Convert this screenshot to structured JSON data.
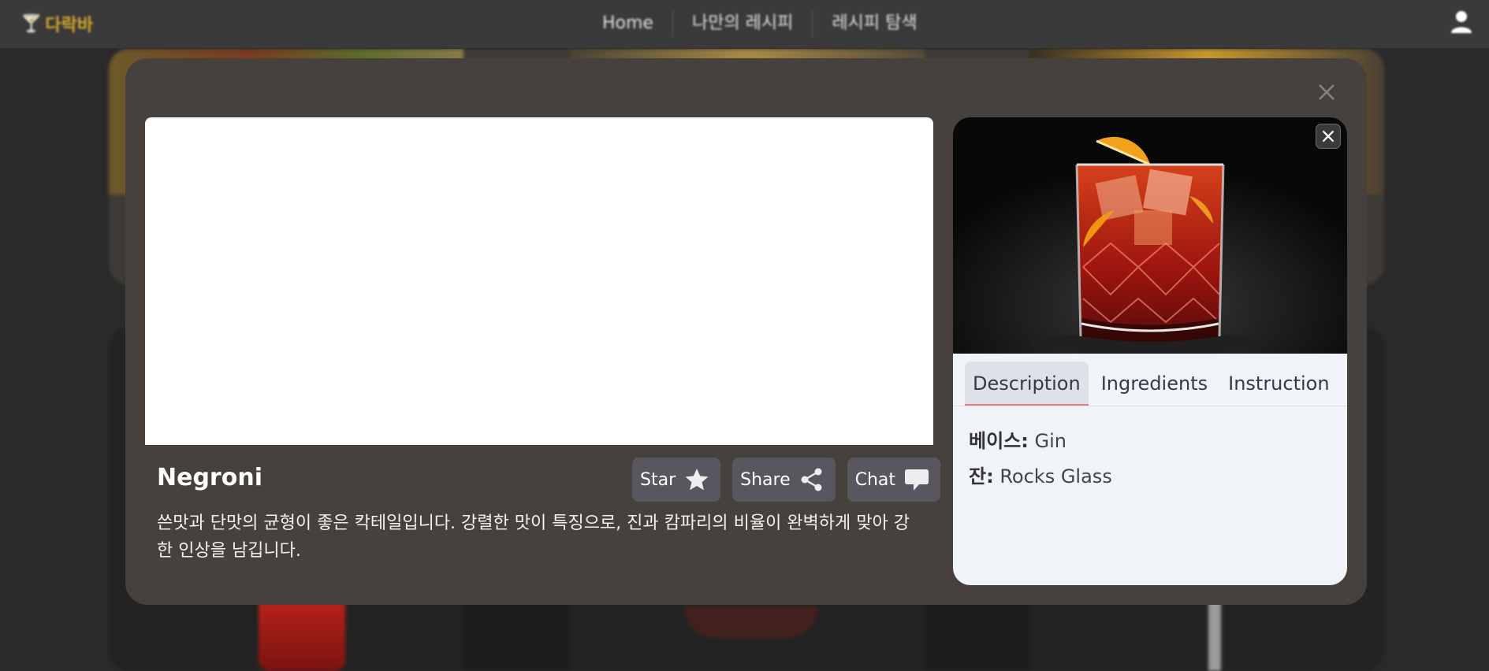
{
  "header": {
    "logo_text": "다락바",
    "nav": [
      "Home",
      "나만의 레시피",
      "레시피 탐색"
    ]
  },
  "modal": {
    "title": "Negroni",
    "description": "쓴맛과 단맛의 균형이 좋은 칵테일입니다. 강렬한 맛이 특징으로, 진과 캄파리의 비율이 완벽하게 맞아 강한 인상을 남깁니다.",
    "actions": {
      "star": "Star",
      "share": "Share",
      "chat": "Chat"
    },
    "tabs": [
      "Description",
      "Ingredients",
      "Instruction"
    ],
    "active_tab": "Description",
    "info": {
      "base_label": "베이스:",
      "base_value": "Gin",
      "glass_label": "잔:",
      "glass_value": "Rocks Glass"
    }
  },
  "colors": {
    "modal_bg": "#46413c",
    "panel_bg": "#f0f3f8",
    "button_bg": "#58575f",
    "tab_accent": "#e57f7f"
  },
  "icons": {
    "logo": "cocktail-glass-icon",
    "user": "user-icon",
    "star": "star-icon",
    "share": "share-icon",
    "chat": "chat-bubble-icon",
    "close": "close-icon"
  }
}
